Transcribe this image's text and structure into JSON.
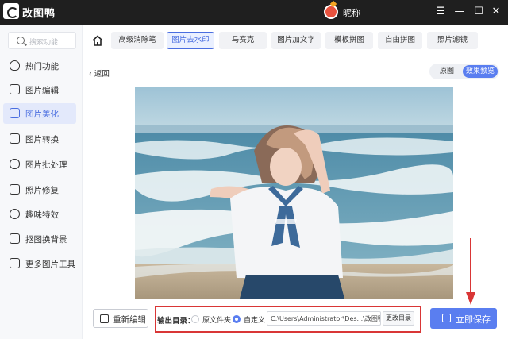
{
  "app": {
    "title": "改图鸭",
    "user_name": "昵称"
  },
  "window_controls": {
    "menu": "☰",
    "minimize": "—",
    "maximize": "☐",
    "close": "✕"
  },
  "sidebar": {
    "search_placeholder": "搜索功能",
    "items": [
      {
        "label": "热门功能",
        "icon": "flame-icon"
      },
      {
        "label": "图片编辑",
        "icon": "image-edit-icon"
      },
      {
        "label": "图片美化",
        "icon": "image-beautify-icon",
        "active": true
      },
      {
        "label": "图片转换",
        "icon": "convert-icon"
      },
      {
        "label": "图片批处理",
        "icon": "batch-icon"
      },
      {
        "label": "照片修复",
        "icon": "repair-icon"
      },
      {
        "label": "趣味特效",
        "icon": "sparkle-icon"
      },
      {
        "label": "抠图换背景",
        "icon": "cutout-icon"
      },
      {
        "label": "更多图片工具",
        "icon": "toolbox-icon"
      }
    ]
  },
  "tabs": [
    {
      "label": "高级消除笔"
    },
    {
      "label": "图片去水印",
      "active": true
    },
    {
      "label": "马赛克"
    },
    {
      "label": "图片加文字"
    },
    {
      "label": "模板拼图"
    },
    {
      "label": "自由拼图"
    },
    {
      "label": "照片滤镜"
    }
  ],
  "subheader": {
    "back_label": "返回",
    "view_toggle": [
      {
        "label": "原图"
      },
      {
        "label": "效果预览",
        "active": true
      }
    ]
  },
  "bottom": {
    "reedit_label": "重新编辑",
    "output_label": "输出目录：",
    "option_original": "原文件夹",
    "option_custom": "自定义",
    "selected_option": "自定义",
    "path_value": "C:\\Users\\Administrator\\Des...\\改图鸭",
    "change_dir_label": "更改目录",
    "save_label": "立即保存"
  },
  "colors": {
    "accent": "#5a7ef0",
    "highlight_box": "#d93636",
    "annotation_arrow": "#d93636"
  }
}
